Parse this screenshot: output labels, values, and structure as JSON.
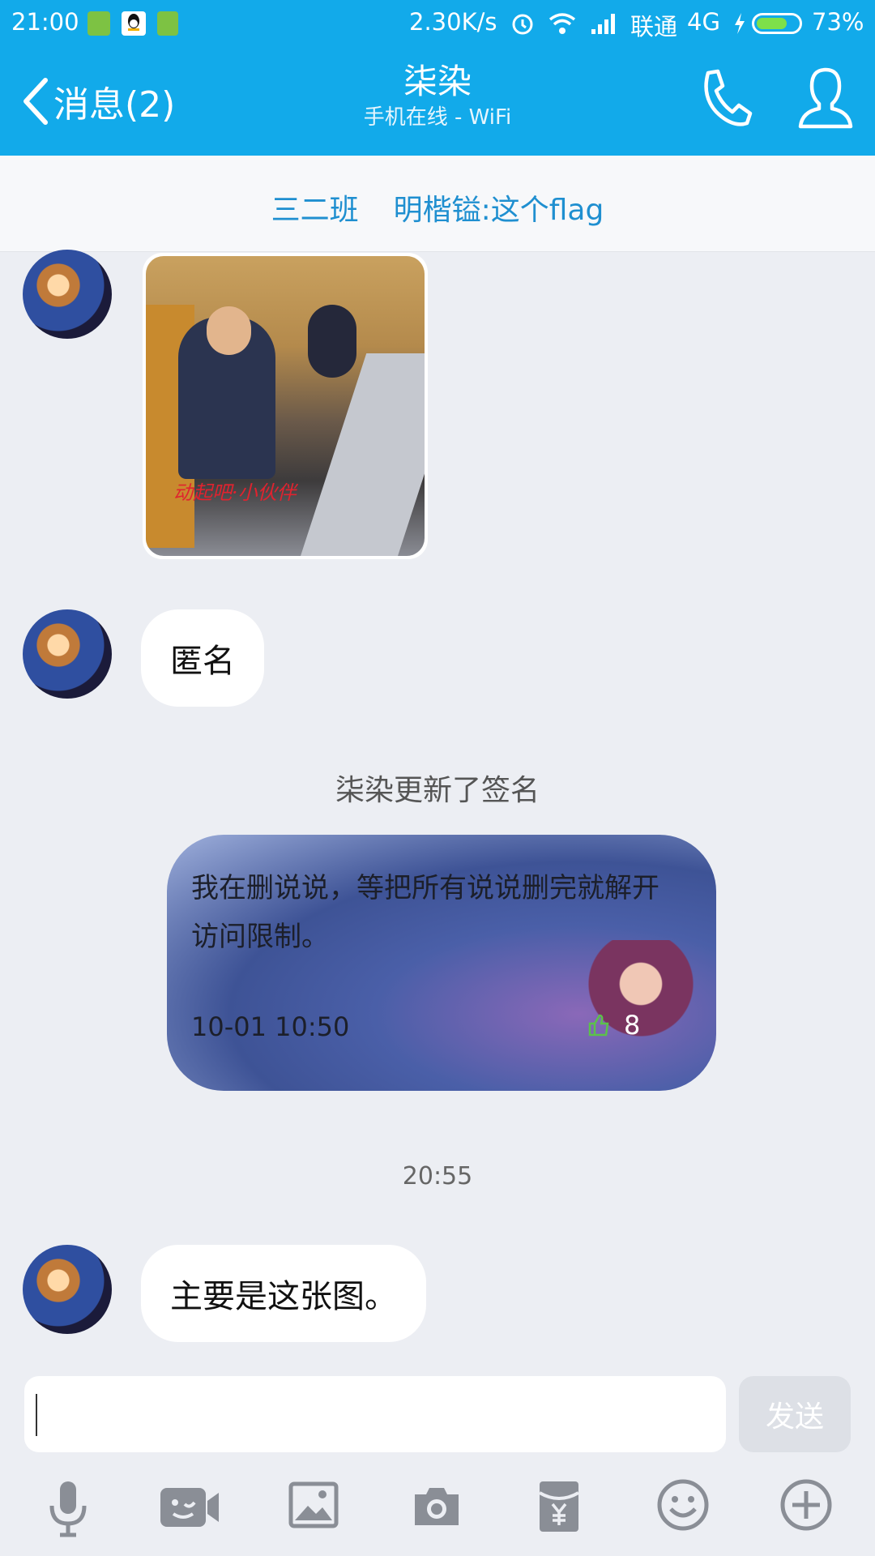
{
  "status_bar": {
    "time": "21:00",
    "net_speed": "2.30K/s",
    "carrier": "联通",
    "network": "4G",
    "battery": "73%",
    "battery_level": 0.73
  },
  "header": {
    "back_label": "消息(2)",
    "contact_name": "柒染",
    "contact_status": "手机在线 - WiFi"
  },
  "banner": {
    "group": "三二班",
    "message": "明楷镒:这个flag"
  },
  "messages": [
    {
      "type": "image",
      "caption": "动起吧·小伙伴"
    },
    {
      "type": "text",
      "text": "匿名"
    },
    {
      "type": "notice",
      "text": "柒染更新了签名"
    },
    {
      "type": "signature",
      "text": "我在删说说，等把所有说说删完就解开访问限制。",
      "date": "10-01 10:50",
      "likes": "8"
    },
    {
      "type": "time",
      "text": "20:55"
    },
    {
      "type": "text",
      "text": "主要是这张图。"
    }
  ],
  "input": {
    "value": "",
    "send_label": "发送"
  },
  "toolbar": {
    "items": [
      "microphone-icon",
      "video-chat-icon",
      "image-icon",
      "camera-icon",
      "red-packet-icon",
      "emoji-icon",
      "plus-icon"
    ]
  },
  "colors": {
    "accent": "#12aaea",
    "banner_text": "#1f8fd0",
    "background": "#eceef3"
  }
}
